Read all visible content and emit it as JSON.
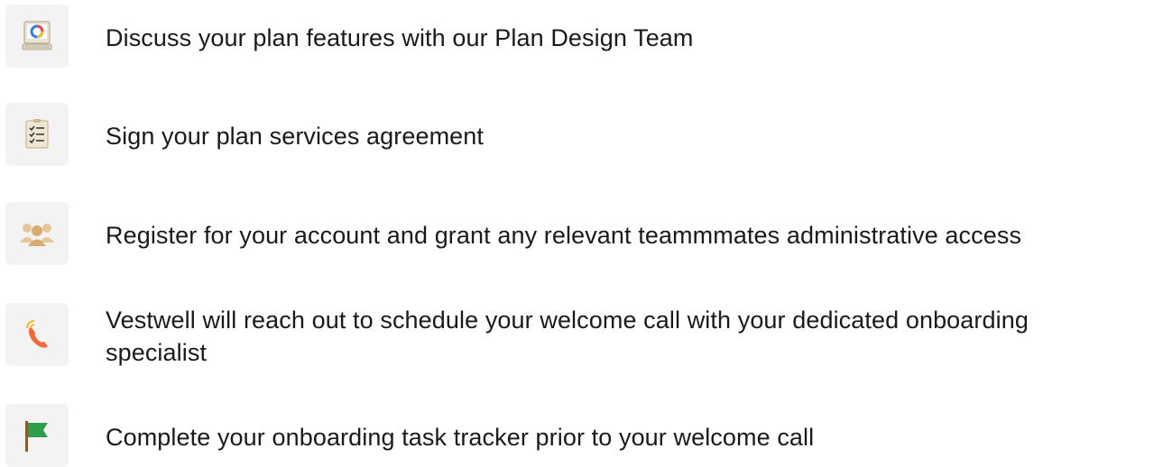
{
  "steps": [
    {
      "icon": "plan-design-icon",
      "text": "Discuss your plan features with our Plan Design Team"
    },
    {
      "icon": "checklist-icon",
      "text": "Sign your plan services agreement"
    },
    {
      "icon": "team-icon",
      "text": "Register for your account and grant any relevant teammmates administrative access"
    },
    {
      "icon": "phone-icon",
      "text": "Vestwell will reach out to schedule your welcome call with your dedicated onboarding specialist"
    },
    {
      "icon": "flag-icon",
      "text": "Complete your onboarding task tracker prior to your welcome call"
    }
  ],
  "colors": {
    "tile_background": "#f3f3f3",
    "text": "#1a1a1a",
    "phone_orange": "#f26a3c",
    "flag_green": "#2e9d4a"
  }
}
